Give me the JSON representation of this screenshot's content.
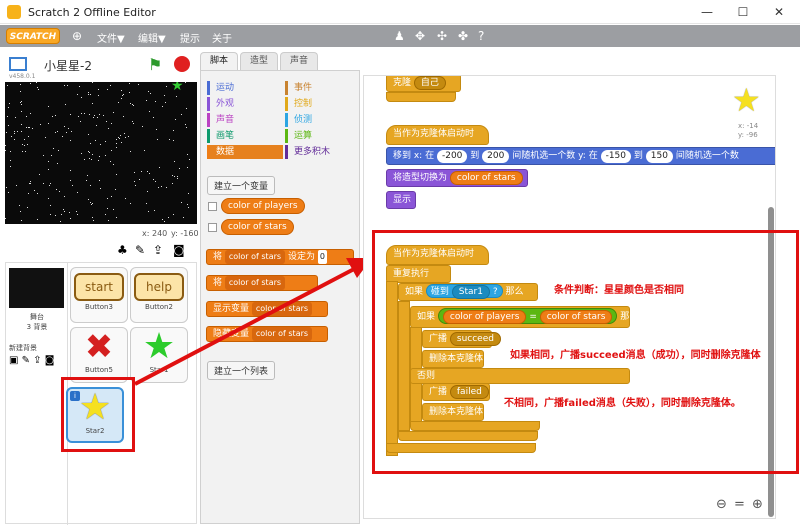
{
  "window": {
    "title": "Scratch 2 Offline Editor",
    "min": "—",
    "max": "☐",
    "close": "✕"
  },
  "menu": {
    "logo": "SCRATCH",
    "file": "文件▼",
    "edit": "编辑▼",
    "tips": "提示",
    "about": "关于"
  },
  "stage": {
    "project_name": "小星星-2",
    "version": "v458.0.1",
    "x_label": "x: 240",
    "y_label": "y: -160"
  },
  "sprites_panel": {
    "stage_label": "舞台",
    "backdrops": "3 背景",
    "new_backdrop": "新建背景",
    "sprites": [
      {
        "name": "Button3",
        "text": "start"
      },
      {
        "name": "Button2",
        "text": "help"
      },
      {
        "name": "Button5"
      },
      {
        "name": "Star1"
      },
      {
        "name": "Star2"
      }
    ]
  },
  "tabs": [
    "脚本",
    "造型",
    "声音"
  ],
  "categories_left": [
    "运动",
    "外观",
    "声音",
    "画笔",
    "数据"
  ],
  "categories_right": [
    "事件",
    "控制",
    "侦测",
    "运算",
    "更多积木"
  ],
  "palette": {
    "make_var": "建立一个变量",
    "vars": [
      "color of players",
      "color of stars"
    ],
    "set_block": "将",
    "set_var": "color of stars",
    "set_to": "设定为",
    "set_val": "0",
    "change_block": "将",
    "change_var": "color of stars",
    "show_var": "显示变量",
    "show_var_name": "color of stars",
    "hide_var": "隐藏变量",
    "hide_var_name": "color of stars",
    "make_list": "建立一个列表"
  },
  "script": {
    "top_block": "克隆",
    "top_drop": "自己",
    "hat1": "当作为克隆体启动时",
    "goto": "移到 x: 在",
    "r1": "-200",
    "to": "到",
    "r2": "200",
    "rand": "间随机选一个数",
    "y": "y: 在",
    "r3": "-150",
    "r4": "150",
    "rand2": "间随机选一个数",
    "switch_costume": "将造型切换为",
    "costume_var": "color of stars",
    "show": "显示",
    "hat2": "当作为克隆体启动时",
    "forever": "重复执行",
    "if1": "如果",
    "touching": "碰到",
    "touch_target": "Star1",
    "q": "?",
    "then1": "那么",
    "if2": "如果",
    "var_a": "color of players",
    "eq": "=",
    "var_b": "color of stars",
    "then2": "那么",
    "broadcast1": "广播",
    "msg1": "succeed",
    "delete1": "删除本克隆体",
    "else": "否则",
    "broadcast2": "广播",
    "msg2": "failed",
    "delete2": "删除本克隆体",
    "sprite_x": "x: -14",
    "sprite_y": "y: -96"
  },
  "annotations": {
    "note1": "条件判断：星星颜色是否相同",
    "note2": "如果相同，广播succeed消息（成功），同时删除克隆体",
    "note3": "不相同，广播failed消息（失败），同时删除克隆体。"
  },
  "colors": {
    "control": "#e6a623",
    "motion": "#4a6cd4",
    "looks": "#8a55d7",
    "data": "#ee7d16",
    "sensing": "#2ca5e2",
    "annotation": "#e01010"
  }
}
